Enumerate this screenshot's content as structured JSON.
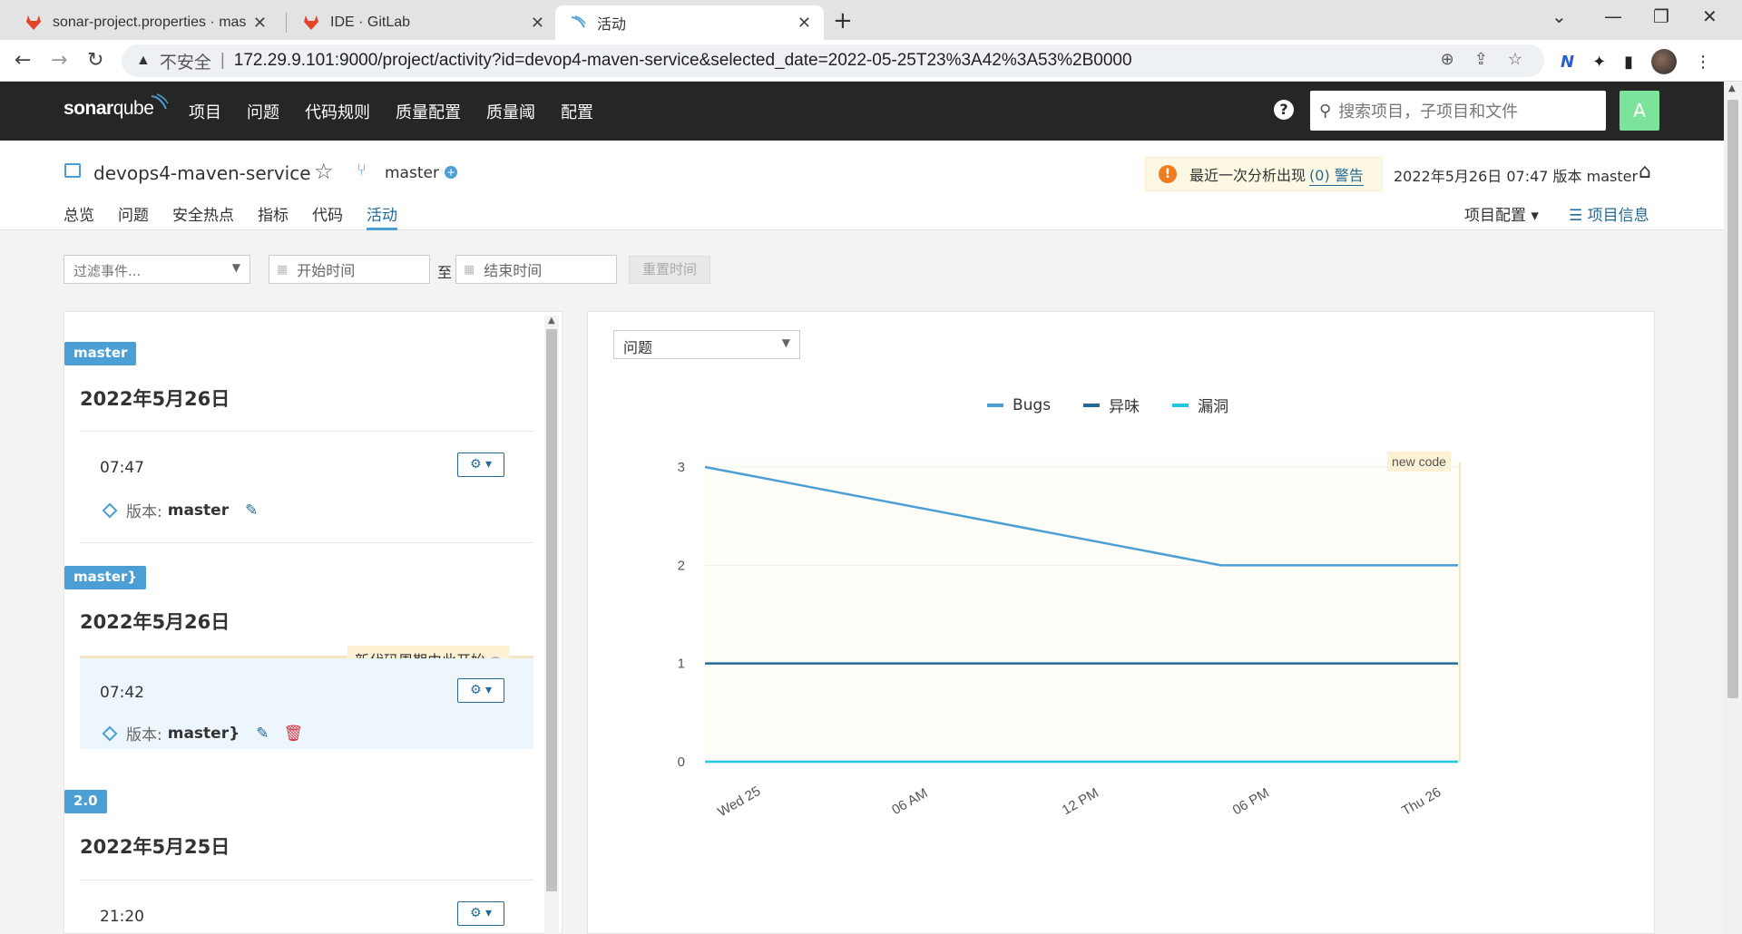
{
  "browser": {
    "tabs": [
      {
        "title": "sonar-project.properties · mas",
        "close": "✕"
      },
      {
        "title": "IDE · GitLab",
        "close": "✕"
      },
      {
        "title": "活动",
        "close": "✕"
      }
    ],
    "new_tab": "+",
    "address": {
      "insecure_label": "不安全",
      "url": "172.29.9.101:9000/project/activity?id=devop4-maven-service&selected_date=2022-05-25T23%3A42%3A53%2B0000"
    }
  },
  "sonar": {
    "logo": {
      "main": "sonar",
      "sub": "qube"
    },
    "menu": [
      "项目",
      "问题",
      "代码规则",
      "质量配置",
      "质量阈",
      "配置"
    ],
    "help": "?",
    "search_placeholder": "搜索项目，子项目和文件",
    "avatar_letter": "A"
  },
  "project": {
    "name": "devops4-maven-service",
    "branch": "master",
    "warning_text": "最近一次分析出现",
    "warning_link": "(0) 警告",
    "analysis_meta": "2022年5月26日 07:47  版本 master",
    "tabs": [
      "总览",
      "问题",
      "安全热点",
      "指标",
      "代码",
      "活动"
    ],
    "active_tab": "活动",
    "config_label": "项目配置",
    "info_label": "项目信息"
  },
  "filters": {
    "event_filter": "过滤事件...",
    "start_date": "开始时间",
    "to": "至",
    "end_date": "结束时间",
    "reset": "重置时间"
  },
  "activity": {
    "groups": [
      {
        "badge": "master",
        "date": "2022年5月26日",
        "time": "07:47",
        "version_label": "版本:",
        "version": "master"
      },
      {
        "badge": "master}",
        "date": "2022年5月26日",
        "time": "07:42",
        "version_label": "版本:",
        "version": "master}",
        "new_code": "新代码周期由此开始"
      },
      {
        "badge": "2.0",
        "date": "2022年5月25日",
        "time": "21:20"
      }
    ]
  },
  "chart_select": "问题",
  "chart_data": {
    "type": "line",
    "x": [
      "Wed 25",
      "06 AM",
      "12 PM",
      "06 PM",
      "Thu 26"
    ],
    "ylim": [
      0,
      3
    ],
    "yticks": [
      0,
      1,
      2,
      3
    ],
    "annotation": "new code",
    "series": [
      {
        "name": "Bugs",
        "color": "#4b9fd5",
        "points": [
          [
            0,
            3
          ],
          [
            0.685,
            2
          ],
          [
            1.0,
            2
          ]
        ]
      },
      {
        "name": "异味",
        "color": "#236a97",
        "points": [
          [
            0,
            1
          ],
          [
            1.0,
            1
          ]
        ]
      },
      {
        "name": "漏洞",
        "color": "#24c6e0",
        "points": [
          [
            0,
            0
          ],
          [
            1.0,
            0
          ]
        ]
      }
    ]
  }
}
